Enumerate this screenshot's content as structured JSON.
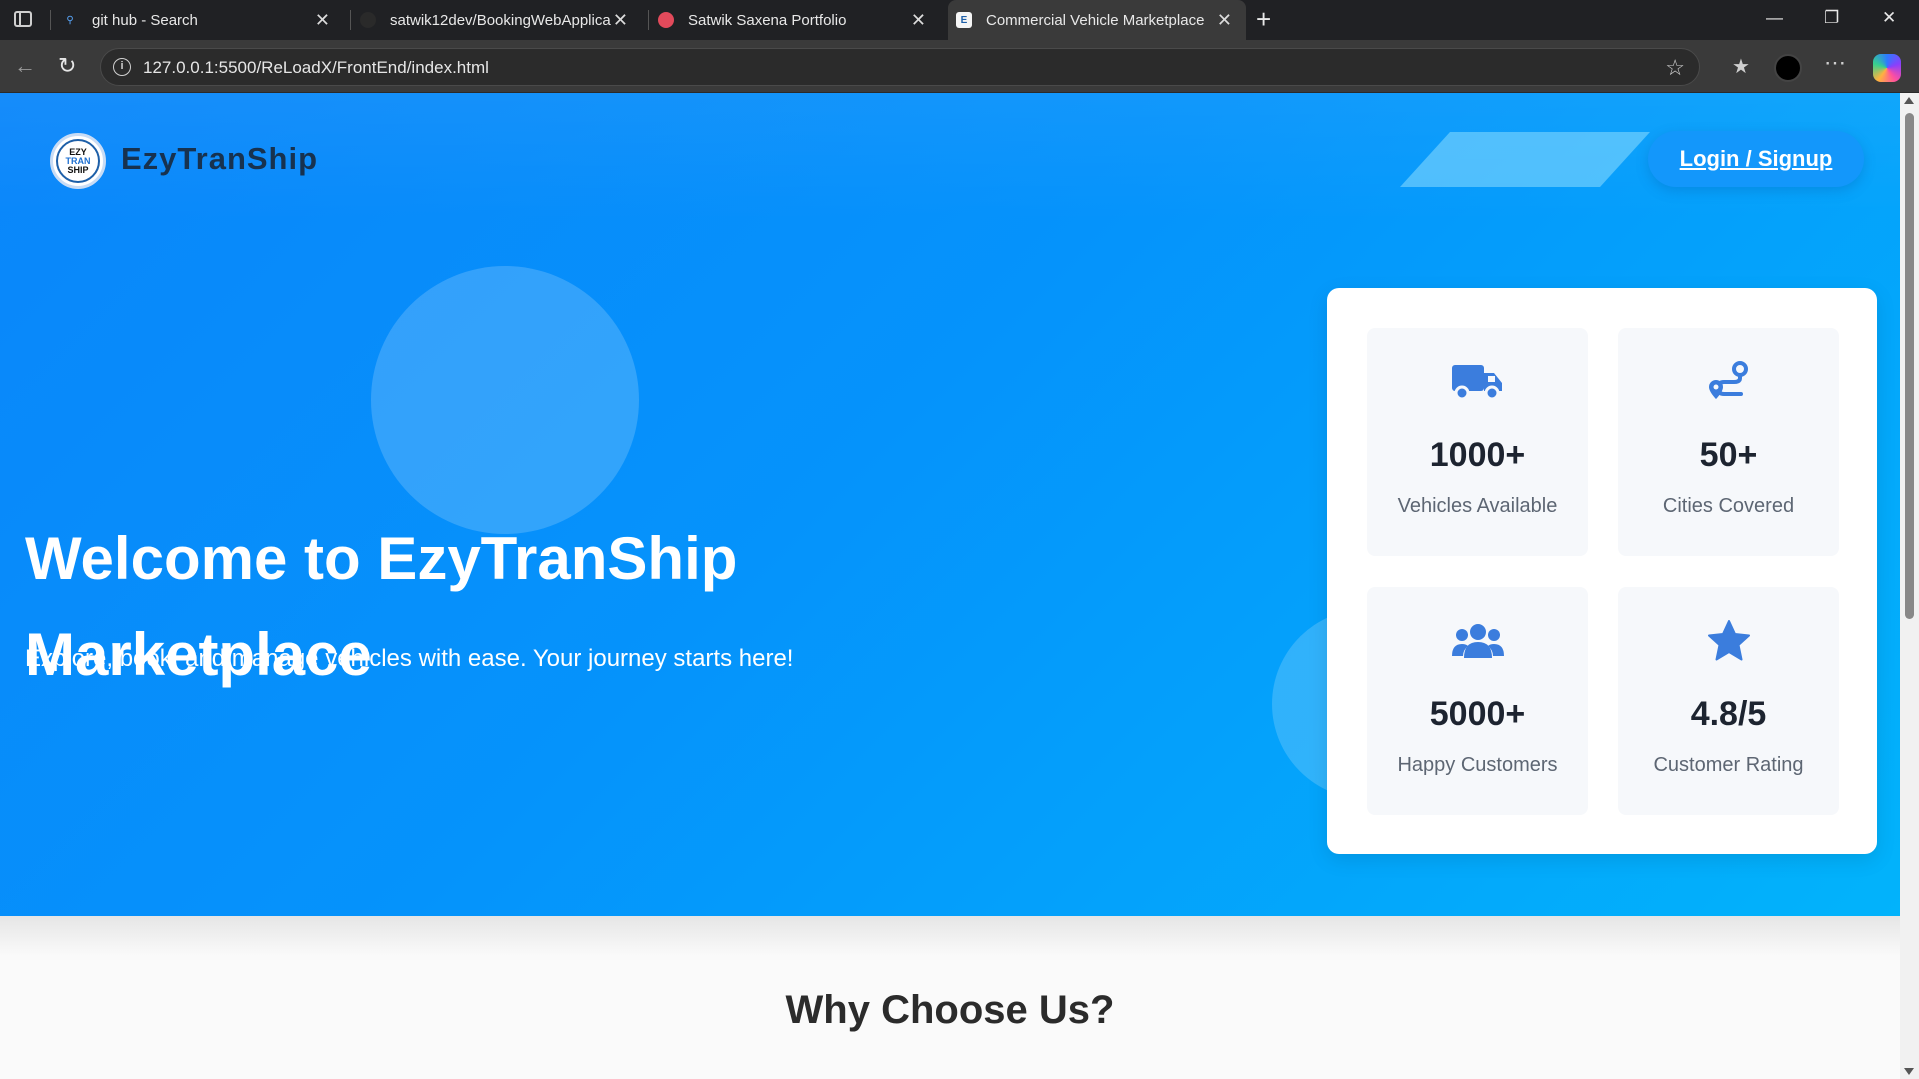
{
  "browser": {
    "tabs": [
      {
        "title": "git hub - Search"
      },
      {
        "title": "satwik12dev/BookingWebApplica"
      },
      {
        "title": "Satwik Saxena Portfolio"
      },
      {
        "title": "Commercial Vehicle Marketplace"
      }
    ],
    "url": "127.0.0.1:5500/ReLoadX/FrontEnd/index.html"
  },
  "header": {
    "logo_lines": [
      "EZY",
      "TRAN",
      "SHIP"
    ],
    "brand": "EzyTranShip",
    "login_label": "Login / Signup"
  },
  "hero": {
    "title": "Welcome to EzyTranShip Marketplace",
    "subtitle": "Explore, book, and manage vehicles with ease. Your journey starts here!"
  },
  "stats": [
    {
      "icon": "truck-icon",
      "value": "1000+",
      "label": "Vehicles Available"
    },
    {
      "icon": "route-icon",
      "value": "50+",
      "label": "Cities Covered"
    },
    {
      "icon": "users-icon",
      "value": "5000+",
      "label": "Happy Customers"
    },
    {
      "icon": "star-icon",
      "value": "4.8/5",
      "label": "Customer Rating"
    }
  ],
  "colors": {
    "accent": "#3b7ddd",
    "hero_start": "#0a86fa",
    "hero_end": "#02b3fb",
    "brand_text": "#17324f"
  },
  "sections": {
    "why_title": "Why Choose Us?"
  }
}
